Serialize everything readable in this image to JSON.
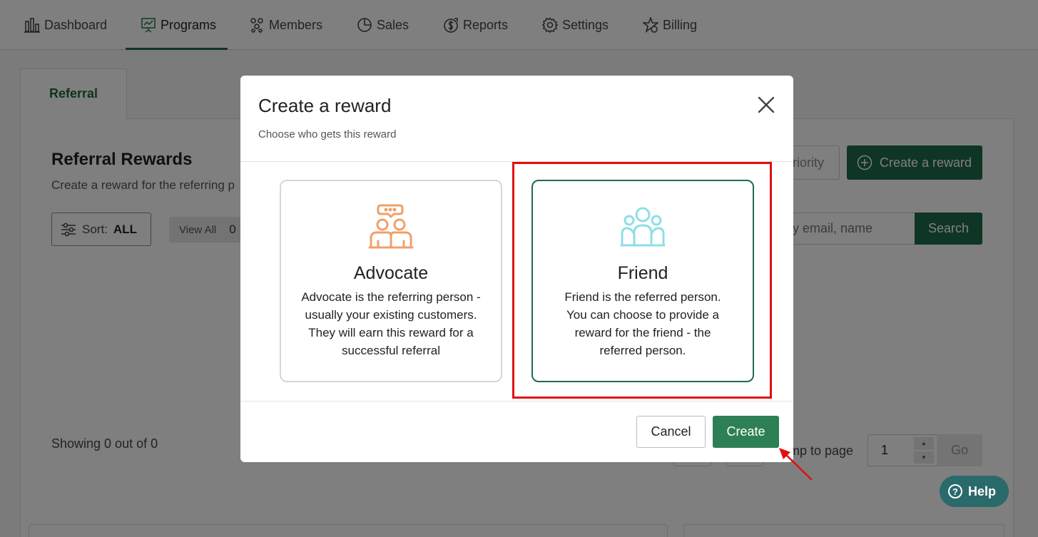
{
  "nav": {
    "items": [
      {
        "label": "Dashboard",
        "icon": "bar-chart-icon"
      },
      {
        "label": "Programs",
        "icon": "presentation-chart-icon",
        "active": true
      },
      {
        "label": "Members",
        "icon": "members-icon"
      },
      {
        "label": "Sales",
        "icon": "pie-chart-icon"
      },
      {
        "label": "Reports",
        "icon": "dollar-report-icon"
      },
      {
        "label": "Settings",
        "icon": "gear-icon"
      },
      {
        "label": "Billing",
        "icon": "star-badge-icon"
      }
    ],
    "active_color": "#1f6b4a"
  },
  "background": {
    "tab": "Referral",
    "title": "Referral Rewards",
    "subtitle": "Create a reward for the referring p",
    "sort_label": "Sort:",
    "sort_value": "ALL",
    "view_all": "View All",
    "view_all_count": "0",
    "priority_label": "riority",
    "create_reward_label": "Create a reward",
    "search_placeholder": "y email, name",
    "search_label": "Search",
    "showing": "Showing 0 out of 0",
    "jump_label": "mp to page",
    "jump_value": "1",
    "go_label": "Go"
  },
  "modal": {
    "title": "Create a reward",
    "subtitle": "Choose who gets this reward",
    "options": [
      {
        "name": "Advocate",
        "description": "Advocate is the referring person - usually your existing customers. They will earn this reward for a successful referral",
        "icon": "advocate-people-chat-icon",
        "icon_color": "#f0a06a"
      },
      {
        "name": "Friend",
        "description": "Friend is the referred person. You can choose to provide a reward for the friend - the referred person.",
        "icon": "friend-group-icon",
        "icon_color": "#8edfe6",
        "selected": true
      }
    ],
    "cancel_label": "Cancel",
    "create_label": "Create"
  },
  "help_label": "Help",
  "colors": {
    "brand_green": "#1f6b4a",
    "create_button": "#2d8055",
    "annotation_red": "#e01010",
    "help_button": "#2a6a6b"
  }
}
